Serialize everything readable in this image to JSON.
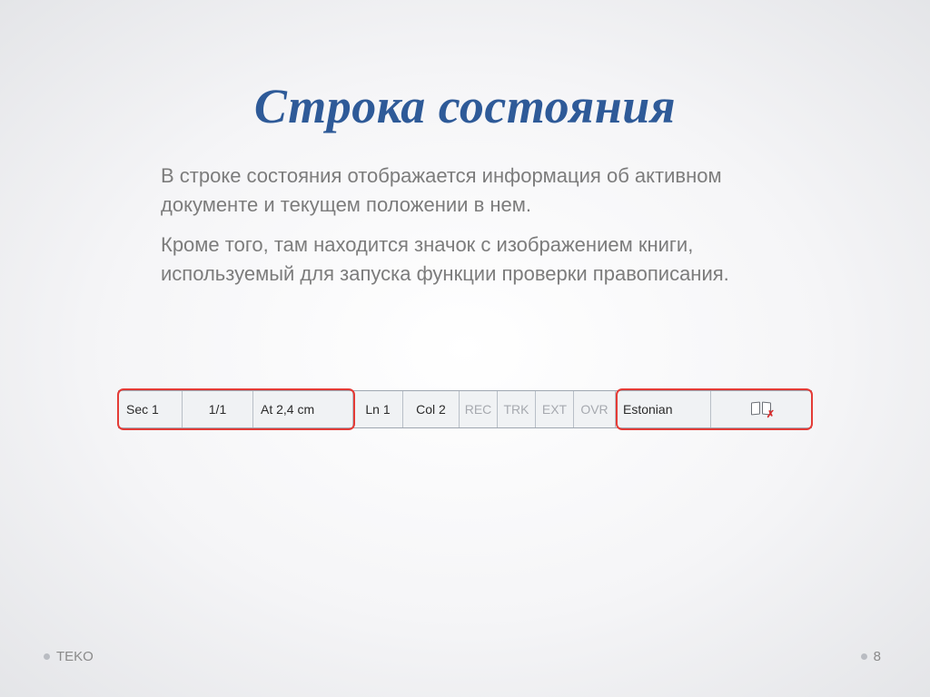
{
  "title": "Строка состояния",
  "paragraphs": {
    "p1": "В строке состояния отображается информация об активном документе и текущем положении в нем.",
    "p2": "Кроме того, там находится значок с изображением книги, используемый для запуска функции проверки правописания."
  },
  "statusbar": {
    "section": "Sec 1",
    "page": "1/1",
    "at": "At 2,4 cm",
    "line": "Ln 1",
    "column": "Col 2",
    "rec": "REC",
    "trk": "TRK",
    "ext": "EXT",
    "ovr": "OVR",
    "language": "Estonian",
    "spellcheck_icon": "book-check-icon"
  },
  "footer": {
    "brand": "TEKO",
    "page_number": "8"
  },
  "colors": {
    "title": "#2e5a98",
    "body_text": "#7c7c7c",
    "highlight_border": "#e43b36"
  }
}
